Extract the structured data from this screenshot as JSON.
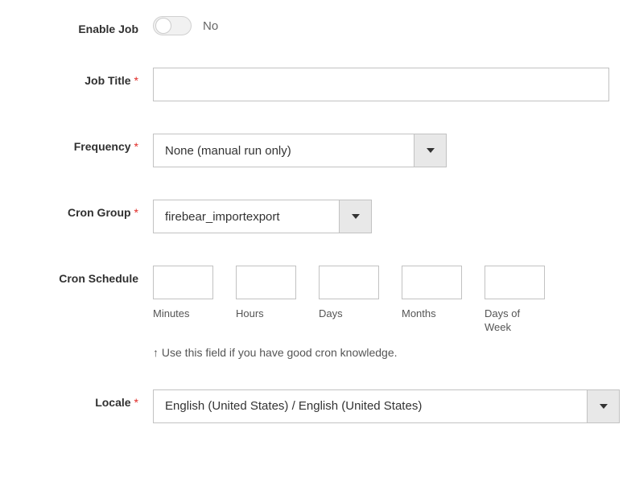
{
  "fields": {
    "enableJob": {
      "label": "Enable Job",
      "stateLabel": "No"
    },
    "jobTitle": {
      "label": "Job Title",
      "value": ""
    },
    "frequency": {
      "label": "Frequency",
      "value": "None (manual run only)"
    },
    "cronGroup": {
      "label": "Cron Group",
      "value": "firebear_importexport"
    },
    "cronSchedule": {
      "label": "Cron Schedule",
      "parts": {
        "minutes": {
          "label": "Minutes",
          "value": ""
        },
        "hours": {
          "label": "Hours",
          "value": ""
        },
        "days": {
          "label": "Days",
          "value": ""
        },
        "months": {
          "label": "Months",
          "value": ""
        },
        "daysOfWeek": {
          "label": "Days of Week",
          "value": ""
        }
      },
      "hint": "↑ Use this field if you have good cron knowledge."
    },
    "locale": {
      "label": "Locale",
      "value": "English (United States) / English (United States)"
    }
  }
}
